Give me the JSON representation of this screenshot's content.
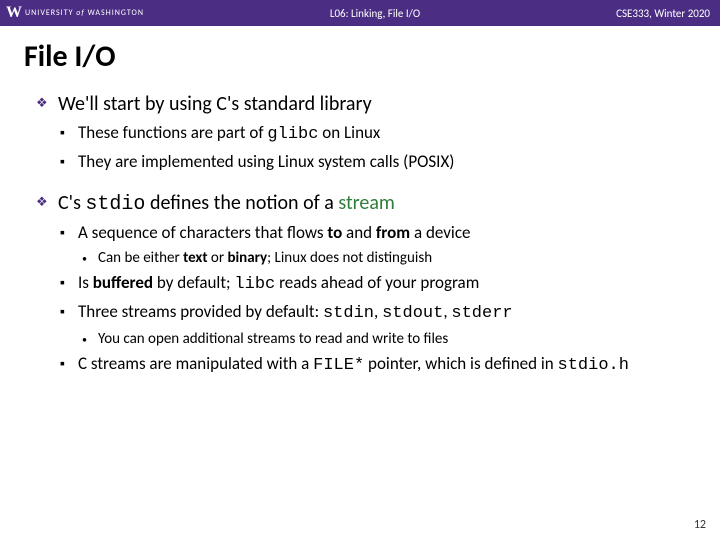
{
  "header": {
    "university_prefix": "UNIVERSITY",
    "university_of": "of",
    "university_name": "WASHINGTON",
    "center": "L06: Linking, File I/O",
    "right": "CSE333, Winter 2020"
  },
  "title": "File I/O",
  "body": {
    "p1": {
      "text": "We'll start by using C's standard library",
      "s1a": "These functions are part of ",
      "s1b": " on Linux",
      "s1_code": "glibc",
      "s2": "They are implemented using Linux system calls (POSIX)"
    },
    "p2": {
      "a": "C's ",
      "code1": "stdio",
      "b": " defines the notion of a ",
      "stream": "stream",
      "s1a": "A sequence of characters that flows ",
      "s1b": "to",
      "s1c": " and ",
      "s1d": "from",
      "s1e": " a device",
      "s1_1a": "Can be either ",
      "s1_1b": "text",
      "s1_1c": " or ",
      "s1_1d": "binary",
      "s1_1e": "; Linux does not distinguish",
      "s2a": "Is ",
      "s2b": "buffered",
      "s2c": " by default; ",
      "s2_code": "libc",
      "s2d": " reads ahead of your program",
      "s3a": "Three streams provided by default: ",
      "s3_c1": "stdin",
      "s3_c2": "stdout",
      "s3_c3": "stderr",
      "s3_1": "You can open additional streams to read and write to files",
      "s4a": "C streams are manipulated with a ",
      "s4_code": "FILE*",
      "s4b": " pointer, which is defined in ",
      "s4_code2": "stdio.h"
    }
  },
  "page": "12"
}
